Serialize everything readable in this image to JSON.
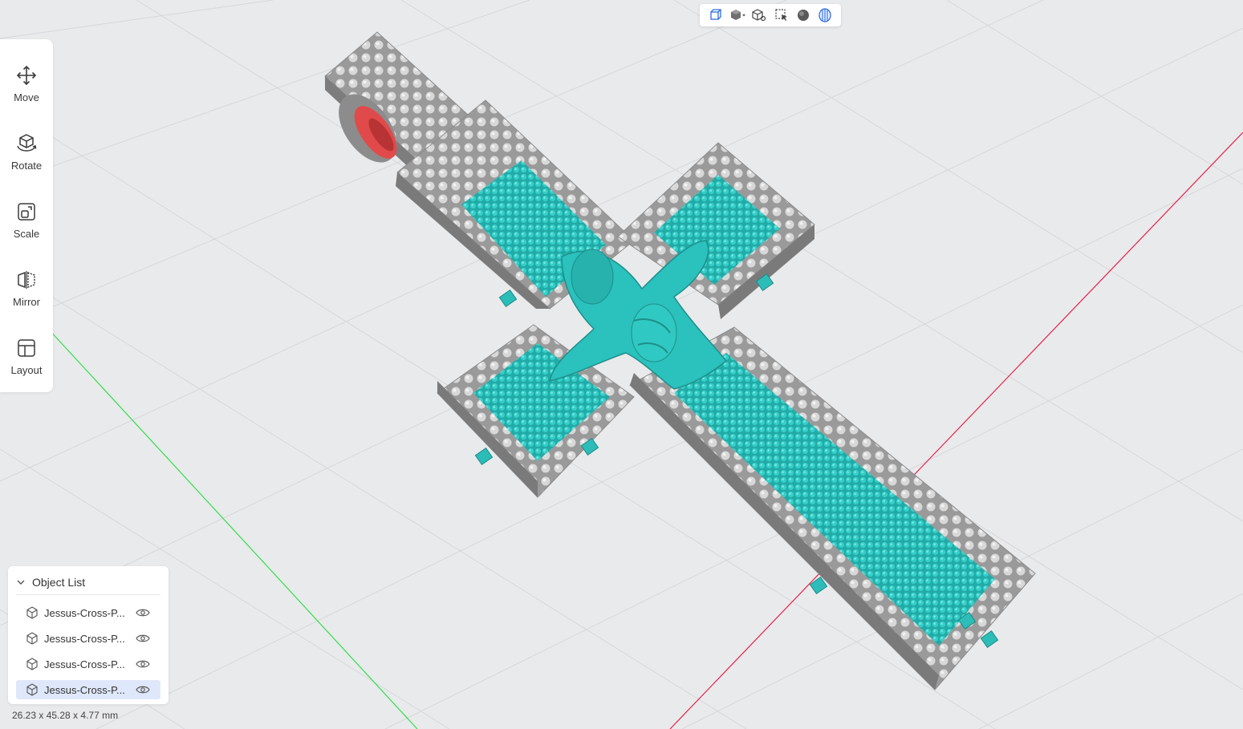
{
  "toolbar_top": {
    "buttons": [
      {
        "icon": "perspective-view-icon"
      },
      {
        "icon": "solid-cube-dropdown-icon"
      },
      {
        "icon": "wireframe-cube-icon"
      },
      {
        "icon": "select-region-icon"
      },
      {
        "icon": "sphere-shading-icon"
      },
      {
        "icon": "support-structure-icon"
      }
    ]
  },
  "tools": [
    {
      "label": "Move",
      "icon": "move-icon"
    },
    {
      "label": "Rotate",
      "icon": "rotate-icon"
    },
    {
      "label": "Scale",
      "icon": "scale-icon"
    },
    {
      "label": "Mirror",
      "icon": "mirror-icon"
    },
    {
      "label": "Layout",
      "icon": "layout-icon"
    }
  ],
  "object_list": {
    "title": "Object List",
    "items": [
      {
        "name": "Jessus-Cross-P...",
        "selected": false
      },
      {
        "name": "Jessus-Cross-P...",
        "selected": false
      },
      {
        "name": "Jessus-Cross-P...",
        "selected": false
      },
      {
        "name": "Jessus-Cross-P...",
        "selected": true
      }
    ]
  },
  "dimensions": "26.23 x 45.28 x 4.77 mm",
  "colors": {
    "background": "#e9eaec",
    "grid": "#d6d7da",
    "axis_x": "#e8204b",
    "axis_y": "#2ee04a",
    "model_metal": "#a9a9a9",
    "model_stone": "#2cc4bf",
    "accent": "#2f6de1"
  }
}
